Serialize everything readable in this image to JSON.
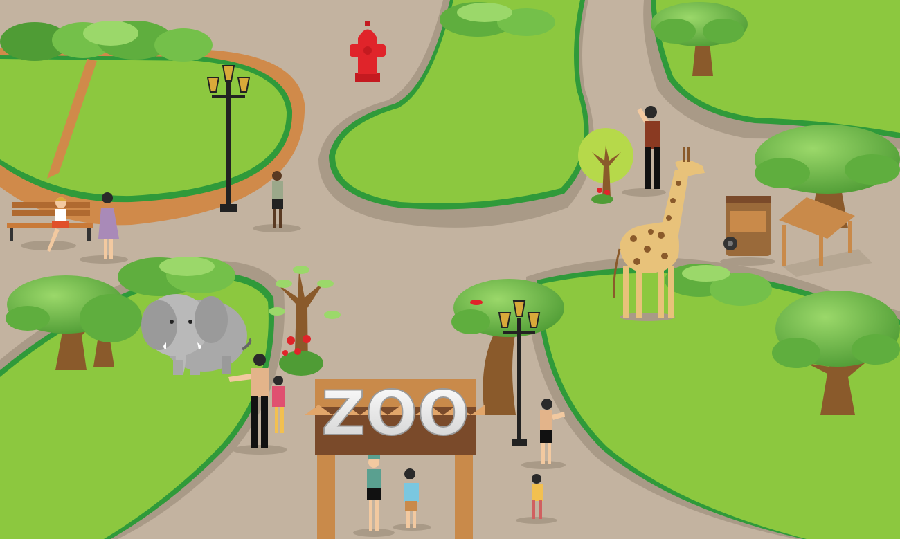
{
  "sign": {
    "text": "ZOO"
  },
  "colors": {
    "path": "#c3b3a0",
    "path_shadow": "#a99a87",
    "grass": "#8cc83f",
    "grass_edge": "#2f9a3a",
    "dirt_track": "#d08a4a",
    "foliage": "#74c04a",
    "foliage_dark": "#3f8f2f",
    "trunk": "#8a5a2b",
    "arch_wood": "#c98a4a",
    "arch_board": "#7a4a2a",
    "hydrant": "#e0242a",
    "elephant": "#b9b9b9",
    "giraffe": "#e8c27a",
    "giraffe_spot": "#8a5a2b"
  },
  "icons": [
    "tree-icon",
    "lamp-post-icon",
    "fire-hydrant-icon",
    "bench-icon",
    "elephant-icon",
    "giraffe-icon",
    "food-cart-icon",
    "kiosk-icon",
    "person-icon",
    "bird-icon",
    "flower-icon"
  ]
}
